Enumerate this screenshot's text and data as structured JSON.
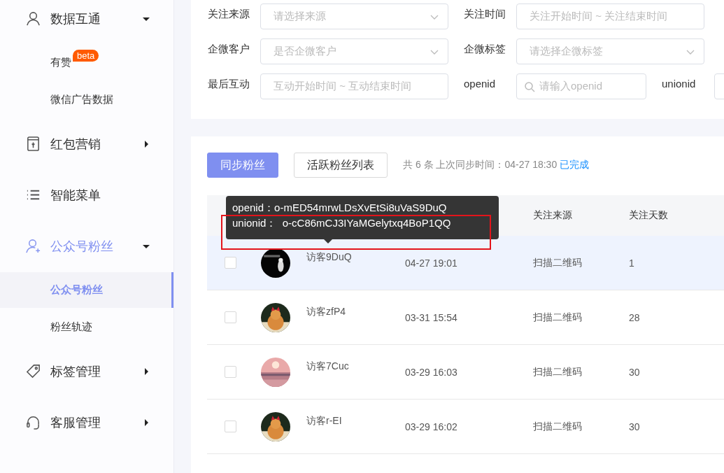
{
  "sidebar": {
    "items": [
      {
        "label": "数据互通",
        "active": false,
        "expanded": true,
        "children": [
          {
            "label": "有赞",
            "badge": "beta",
            "selected": false
          },
          {
            "label": "微信广告数据",
            "selected": false
          }
        ]
      },
      {
        "label": "红包营销",
        "active": false,
        "expanded": false
      },
      {
        "label": "智能菜单",
        "active": false
      },
      {
        "label": "公众号粉丝",
        "active": true,
        "expanded": true,
        "children": [
          {
            "label": "公众号粉丝",
            "selected": true
          },
          {
            "label": "粉丝轨迹",
            "selected": false
          }
        ]
      },
      {
        "label": "标签管理",
        "active": false,
        "expanded": false
      },
      {
        "label": "客服管理",
        "active": false,
        "expanded": false
      }
    ]
  },
  "filters": [
    [
      {
        "label": "关注来源",
        "kind": "select",
        "placeholder": "请选择来源"
      },
      {
        "label": "关注时间",
        "kind": "range",
        "placeholder": "关注开始时间 ~ 关注结束时间"
      }
    ],
    [
      {
        "label": "企微客户",
        "kind": "select",
        "placeholder": "是否企微客户"
      },
      {
        "label": "企微标签",
        "kind": "select",
        "placeholder": "请选择企微标签"
      }
    ],
    [
      {
        "label": "最后互动",
        "kind": "range",
        "placeholder": "互动开始时间 ~ 互动结束时间"
      },
      {
        "label": "openid",
        "kind": "search",
        "placeholder": "请输入openid"
      },
      {
        "label": "unionid",
        "kind": "input"
      }
    ]
  ],
  "toolbar": {
    "buttons": [
      {
        "label": "同步粉丝",
        "kind": "primary"
      },
      {
        "label": "活跃粉丝列表",
        "kind": "default"
      }
    ],
    "summary": "共 6 条 上次同步时间：04-27 18:30",
    "status": "已完成"
  },
  "table": {
    "columns": [
      {
        "label": "关注来源"
      },
      {
        "label": "关注天数"
      }
    ],
    "rows": [
      {
        "name": "访客9DuQ",
        "time": "04-27 19:01",
        "source": "扫描二维码",
        "days": "1",
        "checked": false,
        "highlighted": true
      },
      {
        "name": "访客zfP4",
        "time": "03-31 15:54",
        "source": "扫描二维码",
        "days": "28",
        "checked": false,
        "highlighted": false
      },
      {
        "name": "访客7Cuc",
        "time": "03-29 16:03",
        "source": "扫描二维码",
        "days": "30",
        "checked": false,
        "highlighted": false
      },
      {
        "name": "访客r-EI",
        "time": "03-29 16:02",
        "source": "扫描二维码",
        "days": "30",
        "checked": false,
        "highlighted": false
      }
    ]
  },
  "tooltip": {
    "lines": [
      "openid：o-mED54mrwLDsXvEtSi8uVaS9DuQ",
      "unionid：  o-cC86mCJ3IYaMGelytxq4BoP1QQ"
    ]
  }
}
